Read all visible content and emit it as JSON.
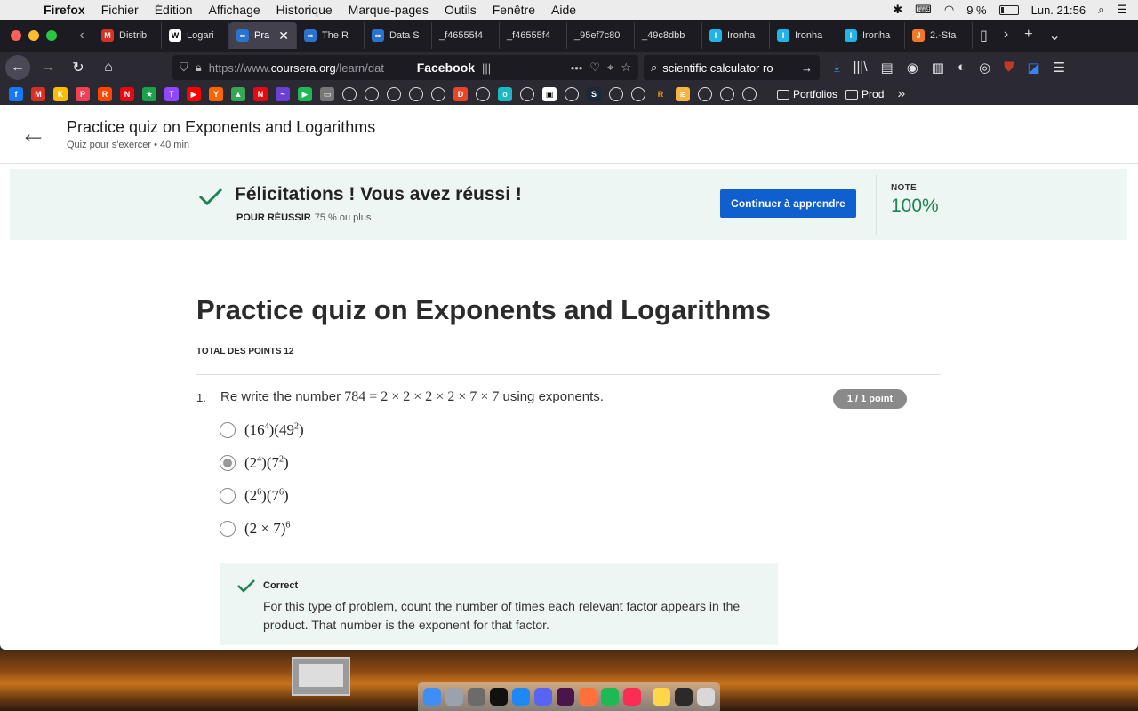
{
  "menubar": {
    "app": "Firefox",
    "items": [
      "Fichier",
      "Édition",
      "Affichage",
      "Historique",
      "Marque-pages",
      "Outils",
      "Fenêtre",
      "Aide"
    ],
    "battery": "9 %",
    "clock": "Lun. 21:56"
  },
  "tabs": [
    {
      "label": "Distrib",
      "favicon": "gmail-icon",
      "color": "#d93025",
      "glyph": "M"
    },
    {
      "label": "Logari",
      "favicon": "wikipedia-icon",
      "color": "#ffffff",
      "glyph": "W"
    },
    {
      "label": "Pra",
      "favicon": "coursera-icon",
      "color": "#2a73cc",
      "glyph": "∞",
      "active": true
    },
    {
      "label": "The R",
      "favicon": "coursera-icon",
      "color": "#2a73cc",
      "glyph": "∞"
    },
    {
      "label": "Data S",
      "favicon": "coursera-icon",
      "color": "#2a73cc",
      "glyph": "∞"
    },
    {
      "label": "_f46555f4",
      "favicon": "",
      "color": "",
      "glyph": ""
    },
    {
      "label": "_f46555f4",
      "favicon": "",
      "color": "",
      "glyph": ""
    },
    {
      "label": "_95ef7c80",
      "favicon": "",
      "color": "",
      "glyph": ""
    },
    {
      "label": "_49c8dbb",
      "favicon": "",
      "color": "",
      "glyph": ""
    },
    {
      "label": "Ironha",
      "favicon": "ironhack-icon",
      "color": "#22b4e6",
      "glyph": "I"
    },
    {
      "label": "Ironha",
      "favicon": "ironhack-icon",
      "color": "#22b4e6",
      "glyph": "I"
    },
    {
      "label": "Ironha",
      "favicon": "ironhack-icon",
      "color": "#22b4e6",
      "glyph": "I"
    },
    {
      "label": "2.-Sta",
      "favicon": "jupyter-icon",
      "color": "#f37726",
      "glyph": "J"
    }
  ],
  "navbar": {
    "url_prefix": "https://www.",
    "url_domain": "coursera.org",
    "url_rest": "/learn/dat",
    "facebook_label": "Facebook",
    "search_text": "scientific calculator ro"
  },
  "bookmarks": {
    "icons": [
      {
        "name": "facebook-bookmark-icon",
        "color": "#1877f2",
        "glyph": "f"
      },
      {
        "name": "gmail-bookmark-icon",
        "color": "#d93025",
        "glyph": "M"
      },
      {
        "name": "keep-bookmark-icon",
        "color": "#fbbc04",
        "glyph": "K"
      },
      {
        "name": "pocket-bookmark-icon",
        "color": "#ef4056",
        "glyph": "P"
      },
      {
        "name": "reddit-bookmark-icon",
        "color": "#ff4500",
        "glyph": "R"
      },
      {
        "name": "netflix-bookmark-icon",
        "color": "#e50914",
        "glyph": "N"
      },
      {
        "name": "star-bookmark-icon",
        "color": "#1aa34a",
        "glyph": "★"
      },
      {
        "name": "twitch-bookmark-icon",
        "color": "#9146ff",
        "glyph": "T"
      },
      {
        "name": "youtube-bookmark-icon",
        "color": "#ff0000",
        "glyph": "▶"
      },
      {
        "name": "ycombinator-bookmark-icon",
        "color": "#ff6600",
        "glyph": "Y"
      },
      {
        "name": "drive-bookmark-icon",
        "color": "#34a853",
        "glyph": "▲"
      },
      {
        "name": "netflix-n-bookmark-icon",
        "color": "#e50914",
        "glyph": "N"
      },
      {
        "name": "purple-bookmark-icon",
        "color": "#6b3fd6",
        "glyph": "~"
      },
      {
        "name": "play-bookmark-icon",
        "color": "#1db954",
        "glyph": "▶"
      },
      {
        "name": "window-bookmark-icon",
        "color": "#777777",
        "glyph": "▭"
      }
    ],
    "folders": [
      "Portfolios",
      "Prod"
    ]
  },
  "page": {
    "header_title": "Practice quiz on Exponents and Logarithms",
    "header_subtitle": "Quiz pour s'exercer • 40  min",
    "banner": {
      "congrats": "Félicitations ! Vous avez réussi !",
      "pass_label": "POUR RÉUSSIR",
      "pass_value": "75 % ou plus",
      "continue_button": "Continuer à apprendre",
      "note_label": "NOTE",
      "note_value": "100%"
    },
    "quiz_title": "Practice quiz on Exponents and Logarithms",
    "total_points": "TOTAL DES POINTS 12",
    "question": {
      "number": "1.",
      "text_before": "Re write the number ",
      "math": "784 = 2 × 2 × 2 × 2 × 7 × 7",
      "text_after": " using exponents.",
      "points": "1 / 1 point",
      "options": [
        {
          "html": "(16<sup>4</sup>)(49<sup>2</sup>)",
          "selected": false
        },
        {
          "html": "(2<sup>4</sup>)(7<sup>2</sup>)",
          "selected": true
        },
        {
          "html": "(2<sup>6</sup>)(7<sup>6</sup>)",
          "selected": false
        },
        {
          "html": "(2 × 7)<sup>6</sup>",
          "selected": false
        }
      ]
    },
    "feedback": {
      "label": "Correct",
      "text": "For this type of problem, count the number of times each relevant factor appears in the product. That number is the exponent for that factor."
    }
  },
  "colors": {
    "accent_blue": "#0f5fcf",
    "success_green": "#1f8354",
    "banner_bg": "#eef6f3"
  }
}
